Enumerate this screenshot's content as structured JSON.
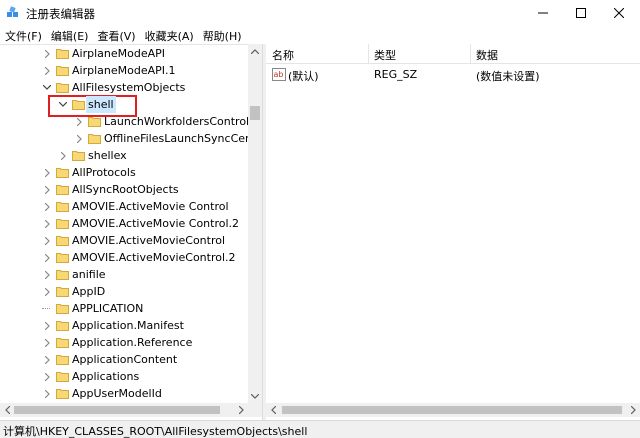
{
  "window": {
    "title": "注册表编辑器",
    "icon": "registry-editor-icon"
  },
  "menu": [
    "文件(F)",
    "编辑(E)",
    "查看(V)",
    "收藏夹(A)",
    "帮助(H)"
  ],
  "tree": {
    "rows": [
      {
        "label": "AirplaneModeAPI",
        "state": "collapsed"
      },
      {
        "label": "AirplaneModeAPI.1",
        "state": "collapsed"
      },
      {
        "label": "AllFilesystemObjects",
        "state": "expanded"
      },
      {
        "label": "shell",
        "state": "expanded",
        "selected": true
      },
      {
        "label": "LaunchWorkfoldersControl",
        "state": "collapsed"
      },
      {
        "label": "OfflineFilesLaunchSyncCenter",
        "state": "collapsed"
      },
      {
        "label": "shellex",
        "state": "collapsed"
      },
      {
        "label": "AllProtocols",
        "state": "collapsed"
      },
      {
        "label": "AllSyncRootObjects",
        "state": "collapsed"
      },
      {
        "label": "AMOVIE.ActiveMovie Control",
        "state": "collapsed"
      },
      {
        "label": "AMOVIE.ActiveMovie Control.2",
        "state": "collapsed"
      },
      {
        "label": "AMOVIE.ActiveMovieControl",
        "state": "collapsed"
      },
      {
        "label": "AMOVIE.ActiveMovieControl.2",
        "state": "collapsed"
      },
      {
        "label": "anifile",
        "state": "collapsed"
      },
      {
        "label": "AppID",
        "state": "collapsed"
      },
      {
        "label": "APPLICATION",
        "state": "leaf"
      },
      {
        "label": "Application.Manifest",
        "state": "collapsed"
      },
      {
        "label": "Application.Reference",
        "state": "collapsed"
      },
      {
        "label": "ApplicationContent",
        "state": "collapsed"
      },
      {
        "label": "Applications",
        "state": "collapsed"
      },
      {
        "label": "AppUserModelId",
        "state": "collapsed"
      }
    ]
  },
  "list": {
    "columns": [
      "名称",
      "类型",
      "数据"
    ],
    "rows": [
      {
        "name": "(默认)",
        "type": "REG_SZ",
        "data": "(数值未设置)",
        "icon": "string-value-icon"
      }
    ]
  },
  "status": {
    "path": "计算机\\HKEY_CLASSES_ROOT\\AllFilesystemObjects\\shell"
  },
  "colors": {
    "selection": "#cce8ff",
    "highlight_box": "#e02020",
    "folder": "#f8d775"
  }
}
